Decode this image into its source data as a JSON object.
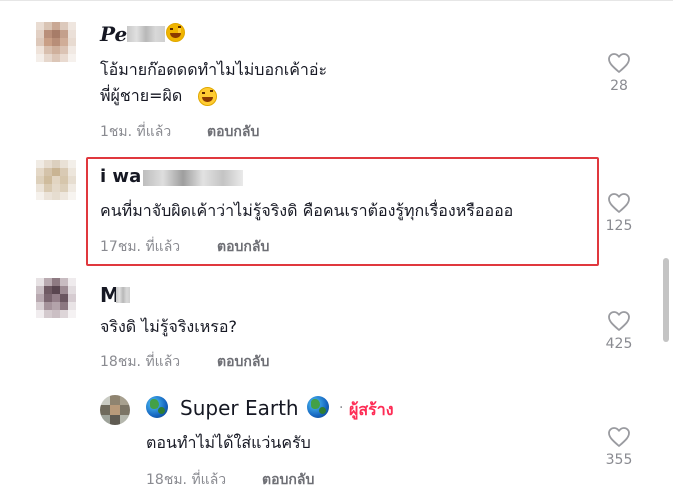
{
  "comments": [
    {
      "username": "Pe",
      "text_lines": [
        "โอ้มายก๊อดดดทำไมไม่บอกเค้าอ่ะ",
        "พี่ผู้ชาย=ผิด"
      ],
      "time": "1ชม. ที่แล้ว",
      "reply_label": "ตอบกลับ",
      "likes": "28"
    },
    {
      "username": "i wa",
      "text_lines": [
        "คนที่มาจับผิดเค้าว่าไม่รู้จริงดิ คือคนเราต้องรู้ทุกเรื่องหรืออออ"
      ],
      "time": "17ชม. ที่แล้ว",
      "reply_label": "ตอบกลับ",
      "likes": "125"
    },
    {
      "username": "M",
      "text_lines": [
        "จริงดิ ไม่รู้จริงเหรอ?"
      ],
      "time": "18ชม. ที่แล้ว",
      "reply_label": "ตอบกลับ",
      "likes": "425"
    },
    {
      "username": "Super Earth",
      "creator_separator": "·",
      "creator_badge": "ผู้สร้าง",
      "text_lines": [
        "ตอนทำไม่ได้ใส่แว่นครับ"
      ],
      "time": "18ชม. ที่แล้ว",
      "reply_label": "ตอบกลับ",
      "likes": "355"
    }
  ],
  "icons": {
    "like": "heart-outline-icon",
    "laugh_emoji": "laughing-face-emoji",
    "globe": "earth-globe-emoji"
  },
  "colors": {
    "creator_badge": "#fe2c55",
    "highlight_box": "#e0383e",
    "meta_text": "#8a8b91"
  }
}
